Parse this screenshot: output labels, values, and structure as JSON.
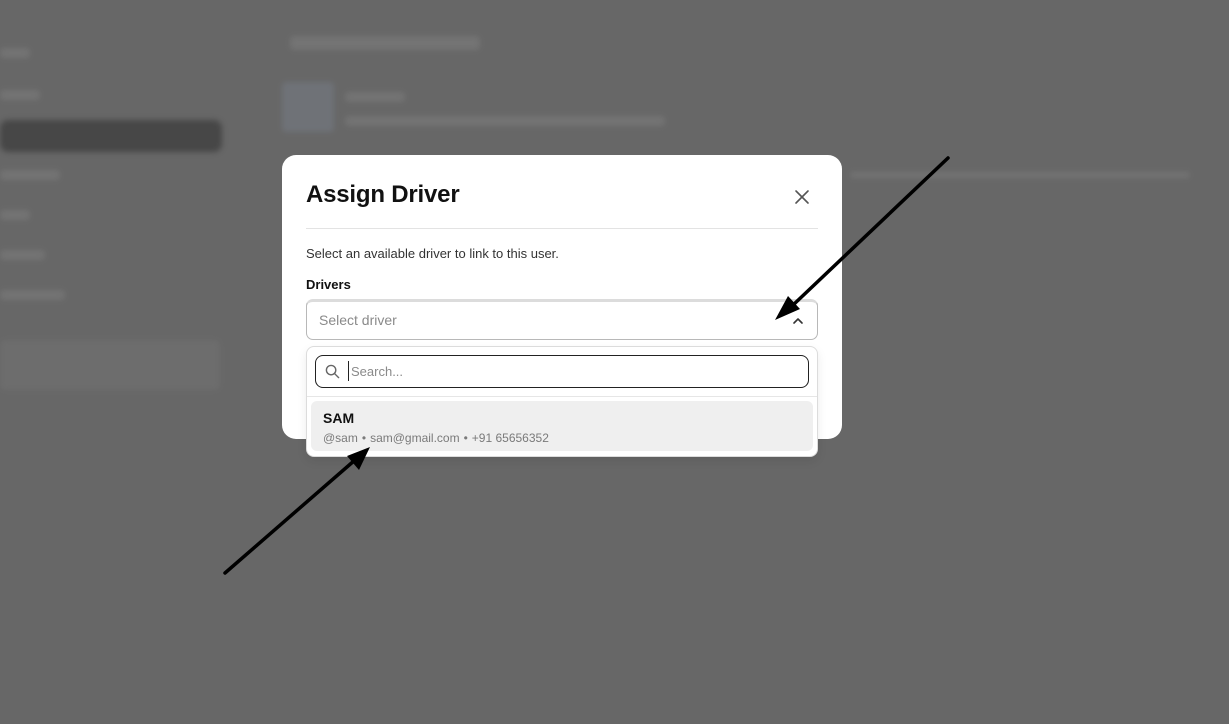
{
  "modal": {
    "title": "Assign Driver",
    "description": "Select an available driver to link to this user.",
    "field_label": "Drivers",
    "select_placeholder": "Select driver",
    "close_icon": "close-icon",
    "chevron_icon": "chevron-up-icon"
  },
  "dropdown": {
    "search_placeholder": "Search...",
    "search_icon": "search-icon",
    "options": [
      {
        "name": "SAM",
        "username": "@sam",
        "email": "sam@gmail.com",
        "phone": "+91 65656352",
        "separator": "•"
      }
    ]
  },
  "annotations": {
    "arrow_color": "#000000",
    "arrows": [
      "arrow-to-select-chevron",
      "arrow-to-option"
    ]
  },
  "colors": {
    "backdrop": "#6b6b6b",
    "modal_bg": "#ffffff",
    "option_highlight": "#efefef"
  }
}
